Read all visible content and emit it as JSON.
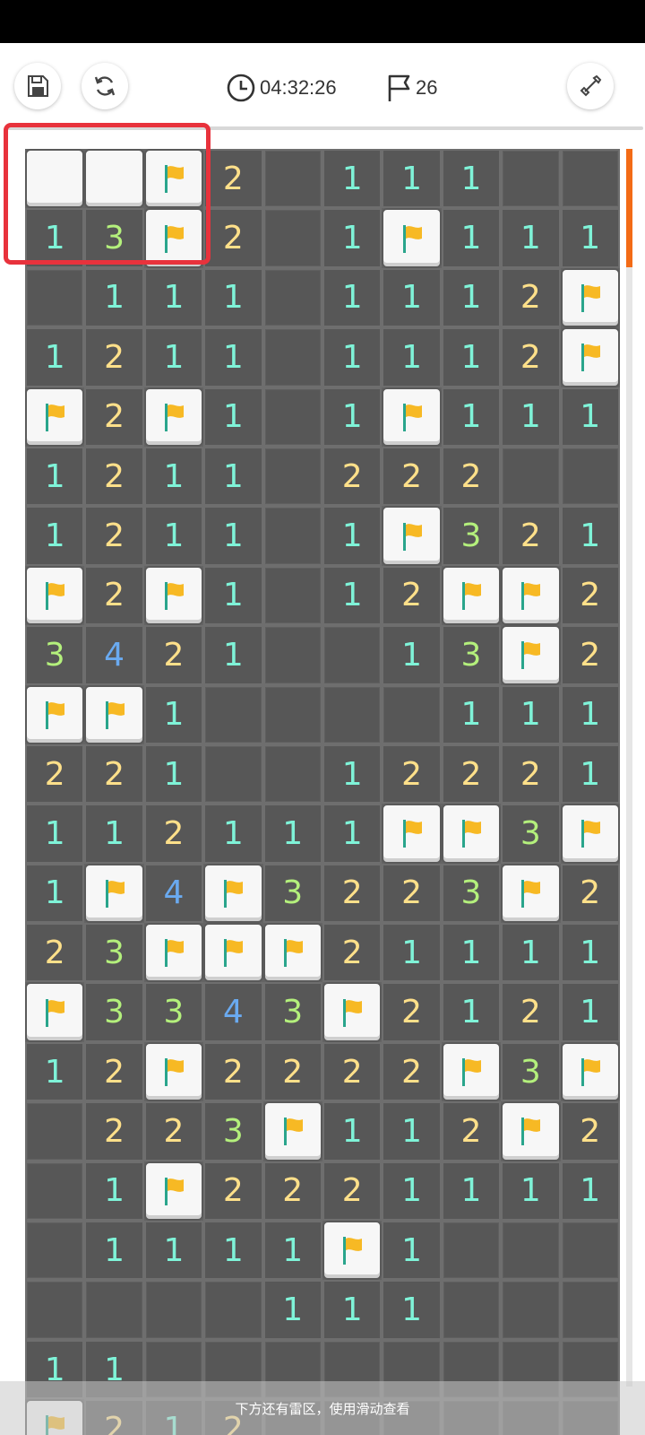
{
  "toolbar": {
    "timer": "04:32:26",
    "flags_remaining": "26",
    "save_icon": "floppy-disk-icon",
    "restart_icon": "refresh-icon",
    "timer_icon": "clock-icon",
    "flag_icon": "flag-outline-icon",
    "pickaxe_icon": "shovel-icon"
  },
  "board": {
    "columns": 10,
    "legend": "' '=covered/unrevealed, F=flag, B=raised blank tile, 0=revealed empty, digits=number",
    "rows": [
      [
        "B",
        "B",
        "F",
        "2",
        " ",
        "1",
        "1",
        "1",
        " ",
        " "
      ],
      [
        "1",
        "3",
        "F",
        "2",
        " ",
        "1",
        "F",
        "1",
        "1",
        "1"
      ],
      [
        " ",
        "1",
        "1",
        "1",
        " ",
        "1",
        "1",
        "1",
        "2",
        "F"
      ],
      [
        "1",
        "2",
        "1",
        "1",
        " ",
        "1",
        "1",
        "1",
        "2",
        "F"
      ],
      [
        "F",
        "2",
        "F",
        "1",
        " ",
        "1",
        "F",
        "1",
        "1",
        "1"
      ],
      [
        "1",
        "2",
        "1",
        "1",
        " ",
        "2",
        "2",
        "2",
        " ",
        " "
      ],
      [
        "1",
        "2",
        "1",
        "1",
        " ",
        "1",
        "F",
        "3",
        "2",
        "1"
      ],
      [
        "F",
        "2",
        "F",
        "1",
        " ",
        "1",
        "2",
        "F",
        "F",
        "2"
      ],
      [
        "3",
        "4",
        "2",
        "1",
        " ",
        " ",
        "1",
        "3",
        "F",
        "2"
      ],
      [
        "F",
        "F",
        "1",
        " ",
        " ",
        " ",
        " ",
        "1",
        "1",
        "1"
      ],
      [
        "2",
        "2",
        "1",
        " ",
        " ",
        "1",
        "2",
        "2",
        "2",
        "1"
      ],
      [
        "1",
        "1",
        "2",
        "1",
        "1",
        "1",
        "F",
        "F",
        "3",
        "F"
      ],
      [
        "1",
        "F",
        "4",
        "F",
        "3",
        "2",
        "2",
        "3",
        "F",
        "2"
      ],
      [
        "2",
        "3",
        "F",
        "F",
        "F",
        "2",
        "1",
        "1",
        "1",
        "1"
      ],
      [
        "F",
        "3",
        "3",
        "4",
        "3",
        "F",
        "2",
        "1",
        "2",
        "1"
      ],
      [
        "1",
        "2",
        "F",
        "2",
        "2",
        "2",
        "2",
        "F",
        "3",
        "F"
      ],
      [
        " ",
        "2",
        "2",
        "3",
        "F",
        "1",
        "1",
        "2",
        "F",
        "2"
      ],
      [
        " ",
        "1",
        "F",
        "2",
        "2",
        "2",
        "1",
        "1",
        "1",
        "1"
      ],
      [
        " ",
        "1",
        "1",
        "1",
        "1",
        "F",
        "1",
        " ",
        " ",
        " "
      ],
      [
        " ",
        " ",
        " ",
        " ",
        "1",
        "1",
        "1",
        " ",
        " ",
        " "
      ],
      [
        "1",
        "1",
        " ",
        " ",
        " ",
        " ",
        " ",
        " ",
        " ",
        " "
      ],
      [
        "F",
        "2",
        "1",
        "2",
        " ",
        " ",
        " ",
        " ",
        " ",
        " "
      ]
    ]
  },
  "colors": {
    "number_1": "#7ff3d8",
    "number_2": "#ffe08a",
    "number_3": "#b4f07c",
    "number_4": "#6aaaf0",
    "flag": "#f7b924",
    "highlight": "#e8323c",
    "scroll_thumb": "#f36b16"
  },
  "hint": "下方还有雷区，使用滑动查看"
}
